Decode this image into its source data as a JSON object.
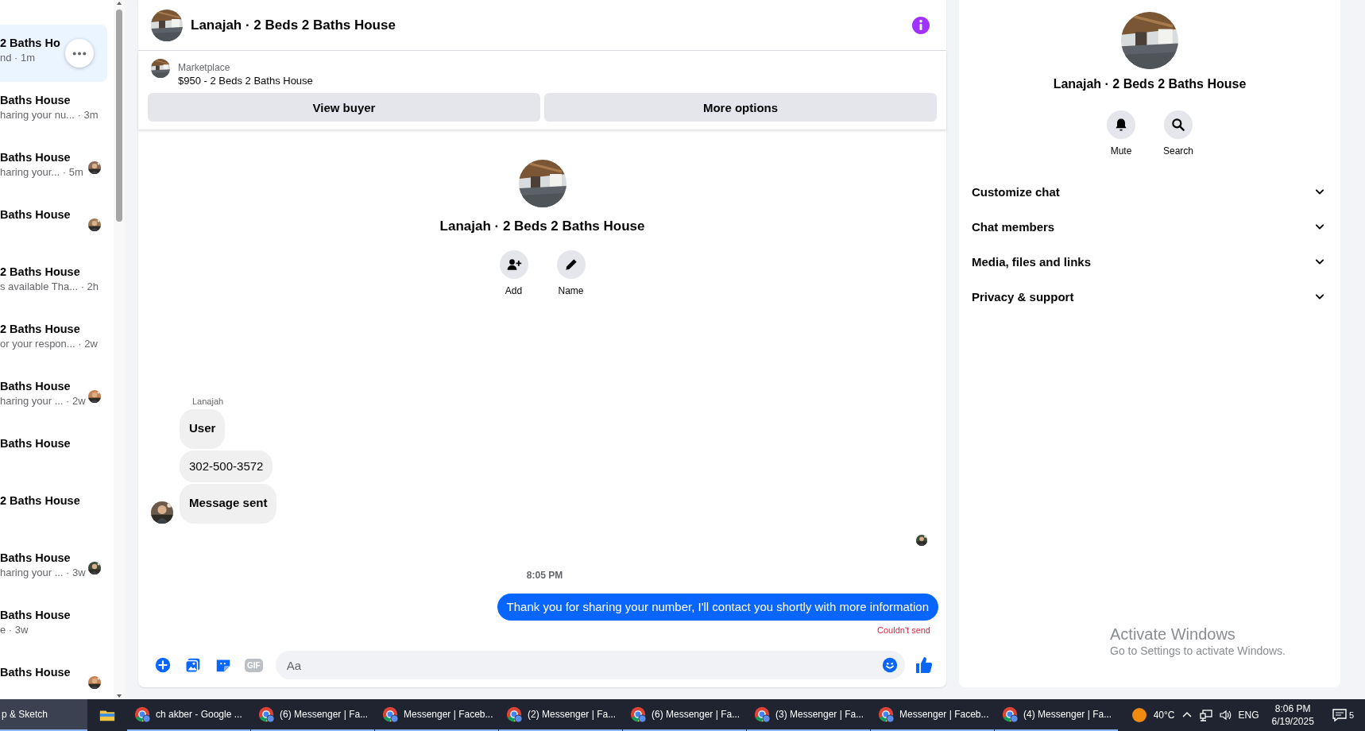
{
  "conversations": [
    {
      "title": "2 Baths Ho",
      "snippet": "nd · 1m",
      "selected": true,
      "menu_button": true
    },
    {
      "title": "Baths House",
      "snippet": "haring your nu... · 3m",
      "selected": false
    },
    {
      "title": "Baths House",
      "snippet": "haring your... · 5m",
      "selected": false
    },
    {
      "title": "Baths House",
      "selected": false
    },
    {
      "title": "2 Baths House",
      "snippet": "s available Tha... · 2h",
      "selected": false
    },
    {
      "title": "2 Baths House",
      "snippet": "or your respon... · 2w",
      "selected": false
    },
    {
      "title": "Baths House",
      "snippet": "haring your ... · 2w",
      "selected": false
    },
    {
      "title": "Baths House",
      "selected": false
    },
    {
      "title": "2 Baths House",
      "selected": false
    },
    {
      "title": "Baths House",
      "snippet": "haring your ... · 3w",
      "selected": false
    },
    {
      "title": "Baths House",
      "snippet": "e · 3w",
      "selected": false
    },
    {
      "title": "Baths House",
      "selected": false
    }
  ],
  "chat": {
    "title": "Lanajah · 2 Beds 2 Baths House",
    "listing": {
      "source": "Marketplace",
      "item": "$950 - 2 Beds 2 Baths House",
      "buttons": [
        "View buyer",
        "More options"
      ]
    },
    "intro": {
      "title": "Lanajah · 2 Beds 2 Baths House",
      "actions": [
        {
          "kind": "add",
          "label": "Add"
        },
        {
          "kind": "name",
          "label": "Name"
        }
      ]
    },
    "messages": [
      {
        "kind": "incoming",
        "sender": "Lanajah",
        "bubbles": [
          {
            "text": "User",
            "bold": true
          },
          {
            "text": "302-500-3572",
            "bold": false
          },
          {
            "text": "Message sent",
            "bold": true
          }
        ]
      },
      {
        "kind": "seen"
      },
      {
        "kind": "time",
        "text": "8:05 PM"
      },
      {
        "kind": "outgoing",
        "text": "Thank you for sharing your number, I'll contact you shortly with more information",
        "status": "Couldn't send"
      }
    ],
    "composer": {
      "gif_label": "GIF",
      "placeholder": "Aa"
    }
  },
  "info_panel": {
    "title": "Lanajah · 2 Beds 2 Baths House",
    "actions": [
      {
        "kind": "mute",
        "label": "Mute"
      },
      {
        "kind": "search",
        "label": "Search"
      }
    ],
    "sections": [
      {
        "label": "Customize chat",
        "expanded": false
      },
      {
        "label": "Chat members",
        "expanded": false
      },
      {
        "label": "Media, files and links",
        "expanded": false
      },
      {
        "label": "Privacy & support",
        "expanded": false
      }
    ]
  },
  "activation_notice": {
    "title": "Activate Windows",
    "text": "Go to Settings to activate Windows."
  },
  "taskbar": {
    "start_app": "p & Sketch",
    "windows": [
      {
        "label": "ch akber - Google ..."
      },
      {
        "label": "(6) Messenger | Fa..."
      },
      {
        "label": "Messenger | Faceb..."
      },
      {
        "label": "(2) Messenger | Fa..."
      },
      {
        "label": "(6) Messenger | Fa..."
      },
      {
        "label": "(3) Messenger | Fa..."
      },
      {
        "label": "Messenger | Faceb..."
      },
      {
        "label": "(4) Messenger | Fa..."
      }
    ],
    "temperature": "40°C",
    "language": "ENG",
    "time": "8:06 PM",
    "date": "6/19/2025",
    "notifications": "5"
  }
}
